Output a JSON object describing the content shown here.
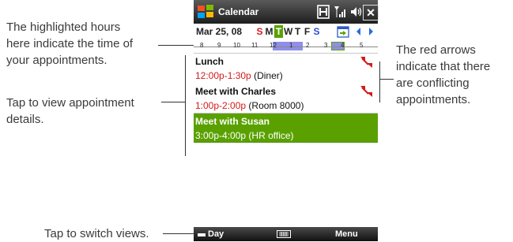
{
  "callouts": {
    "highlighted_hours": [
      "The highlighted hours",
      "here indicate the time of",
      "your appointments."
    ],
    "tap_details": [
      "Tap to view appointment",
      "details."
    ],
    "red_arrows": [
      "The red arrows",
      "indicate that there",
      "are conflicting",
      "appointments."
    ],
    "switch_views": "Tap to switch views."
  },
  "titlebar": {
    "title": "Calendar",
    "close": "✕"
  },
  "datebar": {
    "date": "Mar 25, 08",
    "weekdays": [
      "S",
      "M",
      "T",
      "W",
      "T",
      "F",
      "S"
    ],
    "today_index": 2
  },
  "hours": [
    "8",
    "9",
    "10",
    "11",
    "12",
    "1",
    "2",
    "3",
    "4",
    "5"
  ],
  "appointments": [
    {
      "title": "Lunch",
      "time": "12:00p-1:30p",
      "location": "(Diner)",
      "conflict": true,
      "selected": false
    },
    {
      "title": "Meet with Charles",
      "time": "1:00p-2:00p",
      "location": "(Room 8000)",
      "conflict": true,
      "selected": false
    },
    {
      "title": "Meet with Susan",
      "time": "3:00p-4:00p",
      "location": "(HR office)",
      "conflict": false,
      "selected": true
    }
  ],
  "softkeys": {
    "left": "Day",
    "right": "Menu"
  },
  "colors": {
    "selected_bg": "#5aa100",
    "today_bg": "#5aa100",
    "weekend_red": "#d21a1a",
    "time_red": "#d21a1a",
    "hour_highlight": "#8f8fe8"
  }
}
